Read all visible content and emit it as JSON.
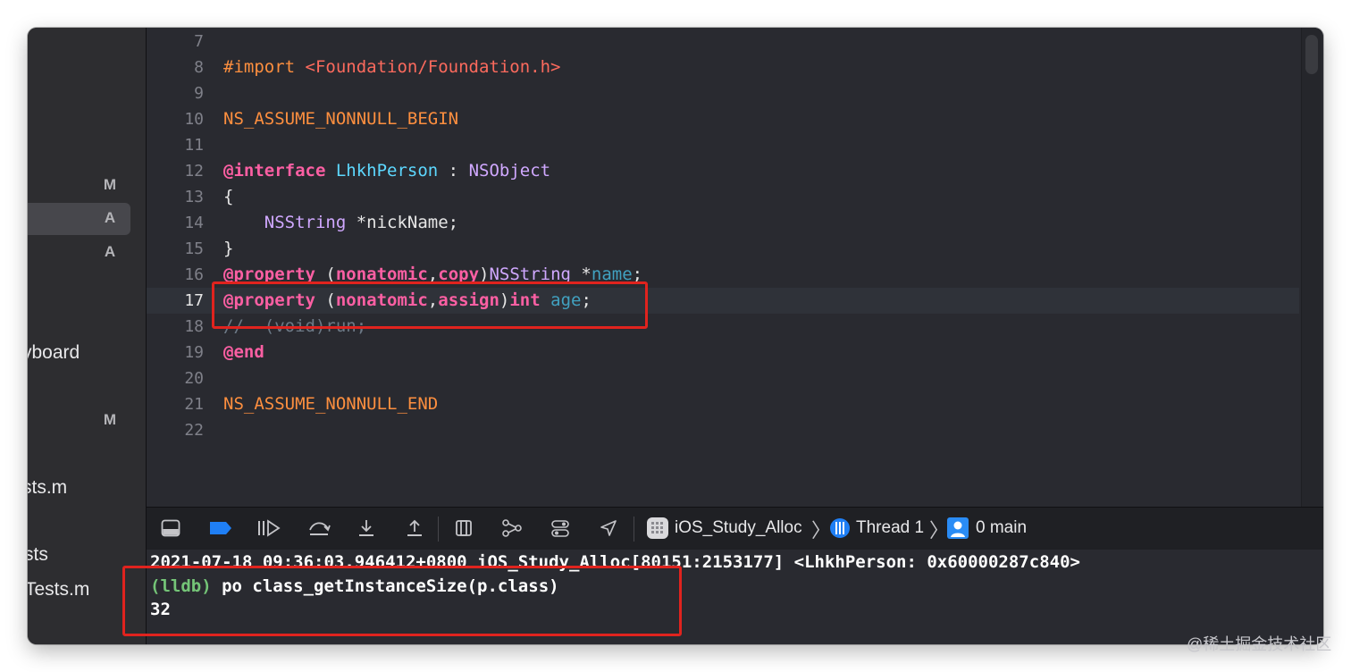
{
  "sidebar": {
    "badges": [
      "M",
      "A",
      "A",
      "M"
    ],
    "files": [
      "yboard",
      "sts.m",
      "sts",
      "Tests.m"
    ]
  },
  "editor": {
    "lines": [
      {
        "n": "7",
        "segs": []
      },
      {
        "n": "8",
        "segs": [
          {
            "c": "prep",
            "t": "#import "
          },
          {
            "c": "str",
            "t": "<Foundation/Foundation.h>"
          }
        ]
      },
      {
        "n": "9",
        "segs": []
      },
      {
        "n": "10",
        "segs": [
          {
            "c": "prep",
            "t": "NS_ASSUME_NONNULL_BEGIN"
          }
        ]
      },
      {
        "n": "11",
        "segs": []
      },
      {
        "n": "12",
        "segs": [
          {
            "c": "kw",
            "t": "@interface "
          },
          {
            "c": "cls",
            "t": "LhkhPerson"
          },
          {
            "c": "plain",
            "t": " : "
          },
          {
            "c": "typ",
            "t": "NSObject"
          }
        ]
      },
      {
        "n": "13",
        "segs": [
          {
            "c": "plain",
            "t": "{"
          }
        ]
      },
      {
        "n": "14",
        "segs": [
          {
            "c": "plain",
            "t": "    "
          },
          {
            "c": "typ",
            "t": "NSString"
          },
          {
            "c": "plain",
            "t": " *nickName;"
          }
        ]
      },
      {
        "n": "15",
        "segs": [
          {
            "c": "plain",
            "t": "}"
          }
        ]
      },
      {
        "n": "16",
        "segs": [
          {
            "c": "kw",
            "t": "@property"
          },
          {
            "c": "plain",
            "t": " ("
          },
          {
            "c": "kw",
            "t": "nonatomic"
          },
          {
            "c": "plain",
            "t": ","
          },
          {
            "c": "kw",
            "t": "copy"
          },
          {
            "c": "plain",
            "t": ")"
          },
          {
            "c": "typ",
            "t": "NSString"
          },
          {
            "c": "plain",
            "t": " *"
          },
          {
            "c": "prop",
            "t": "name"
          },
          {
            "c": "plain",
            "t": ";"
          }
        ]
      },
      {
        "n": "17",
        "current": true,
        "segs": [
          {
            "c": "kw",
            "t": "@property"
          },
          {
            "c": "plain",
            "t": " ("
          },
          {
            "c": "kw",
            "t": "nonatomic"
          },
          {
            "c": "plain",
            "t": ","
          },
          {
            "c": "kw",
            "t": "assign"
          },
          {
            "c": "plain",
            "t": ")"
          },
          {
            "c": "kw",
            "t": "int"
          },
          {
            "c": "plain",
            "t": " "
          },
          {
            "c": "prop",
            "t": "age"
          },
          {
            "c": "plain",
            "t": ";"
          }
        ]
      },
      {
        "n": "18",
        "segs": [
          {
            "c": "cmt",
            "t": "//- (void)run;"
          }
        ]
      },
      {
        "n": "19",
        "segs": [
          {
            "c": "kw",
            "t": "@end"
          }
        ]
      },
      {
        "n": "20",
        "segs": []
      },
      {
        "n": "21",
        "segs": [
          {
            "c": "prep",
            "t": "NS_ASSUME_NONNULL_END"
          }
        ]
      },
      {
        "n": "22",
        "segs": []
      }
    ]
  },
  "debugbar": {
    "breadcrumb": {
      "scheme": "iOS_Study_Alloc",
      "thread": "Thread 1",
      "frame": "0 main"
    },
    "icons": [
      "hide-debug-area-icon",
      "breakpoints-toggle-icon",
      "continue-icon",
      "step-over-icon",
      "step-into-icon",
      "step-out-icon",
      "view-hierarchy-icon",
      "memory-graph-icon",
      "environment-overrides-icon",
      "simulate-location-icon"
    ],
    "colors": {
      "accent": "#1f7ff5"
    }
  },
  "console": {
    "lines": [
      {
        "prompt": "",
        "text": "2021-07-18 09:36:03.946412+0800 iOS_Study_Alloc[80151:2153177] <LhkhPerson: 0x60000287c840>"
      },
      {
        "prompt": "(lldb)",
        "text": " po class_getInstanceSize(p.class)"
      },
      {
        "prompt": "",
        "text": "32"
      }
    ]
  },
  "watermark": "@稀土掘金技术社区",
  "annotation_color": "#e0231e"
}
